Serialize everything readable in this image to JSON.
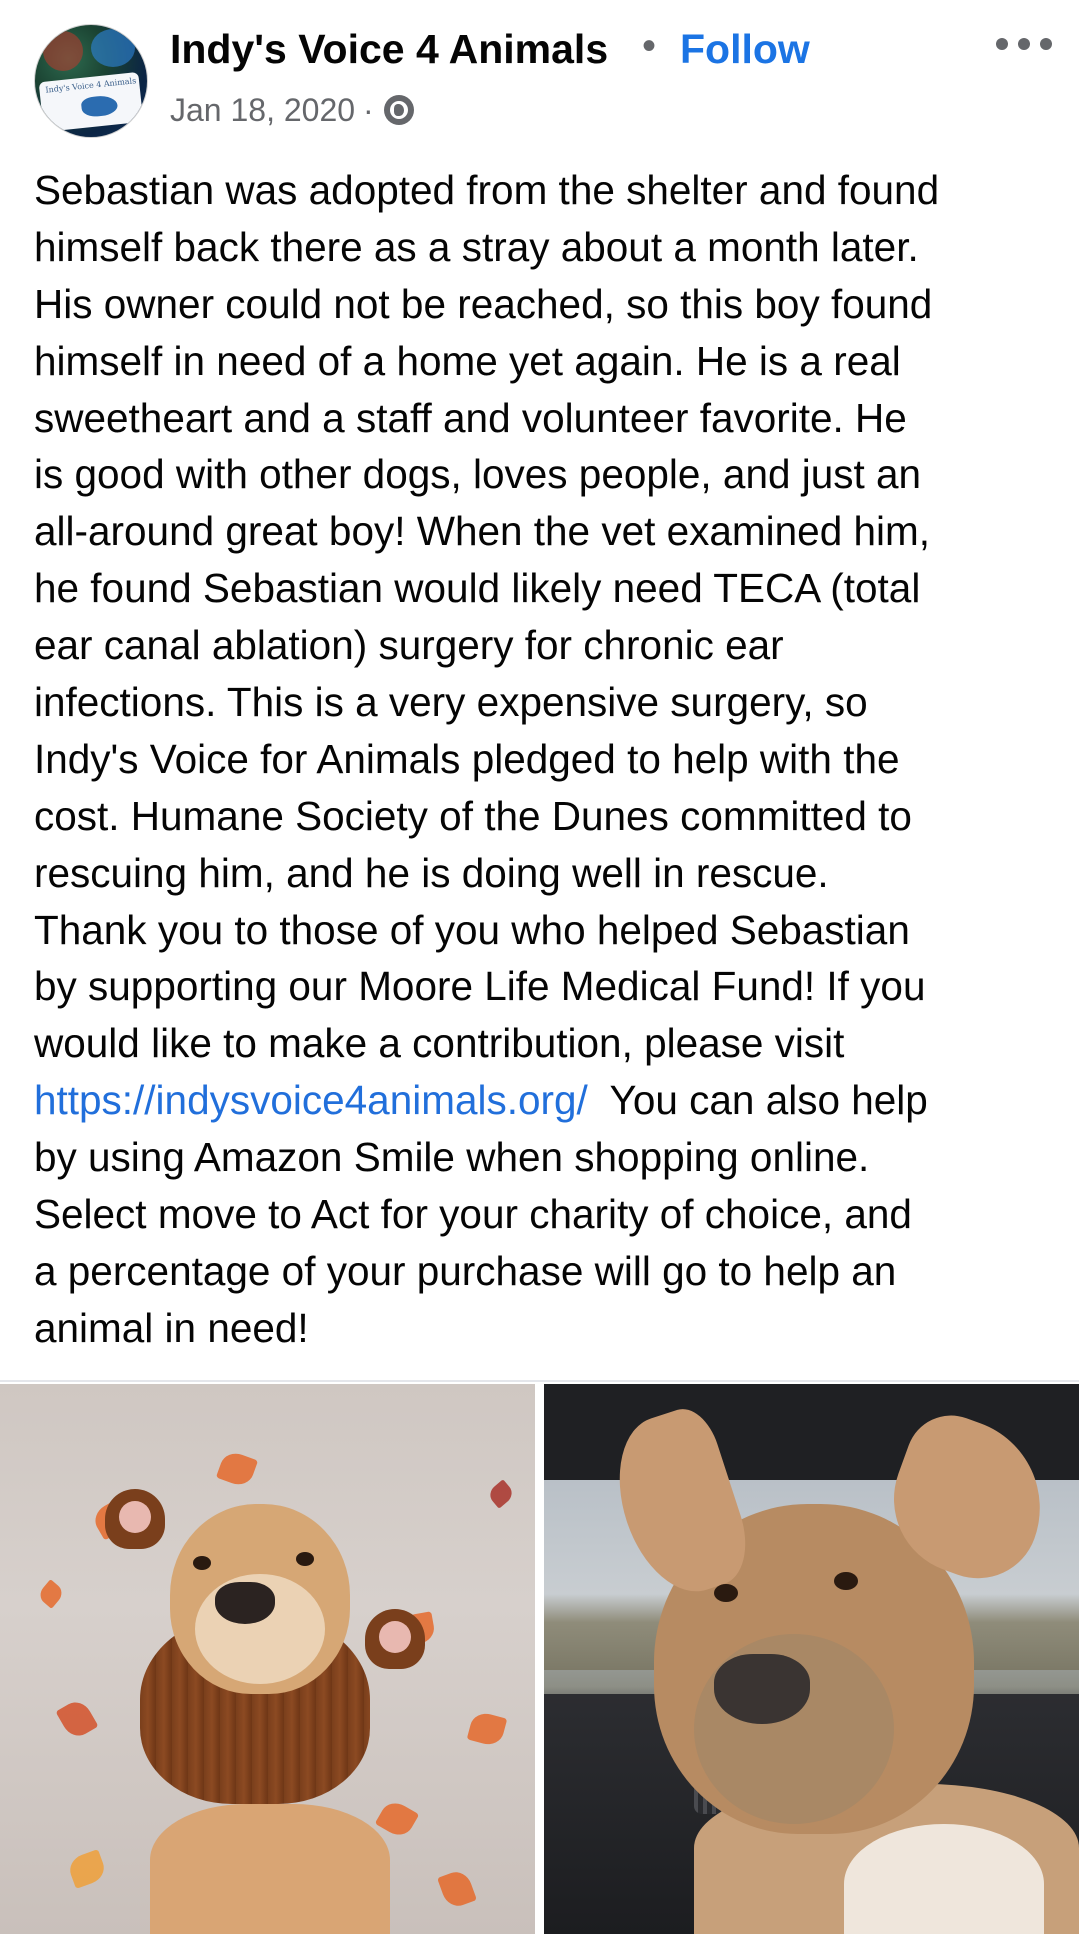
{
  "post": {
    "author": "Indy's Voice 4 Animals",
    "separator": "•",
    "follow_label": "Follow",
    "date": "Jan 18, 2020",
    "meta_separator": "·",
    "privacy_icon": "globe-icon",
    "more_icon": "more-options-icon",
    "avatar_badge_text": "Indy's Voice 4 Animals",
    "body_lines": [
      "Sebastian was adopted from the shelter and found",
      "himself back there as a stray about a month later.",
      "His owner could not be reached, so this boy found",
      "himself in need of a home yet again.  He is a real",
      "sweetheart and a staff and volunteer favorite.  He",
      "is good with other dogs, loves people, and just an",
      "all-around great boy!  When the vet examined him,",
      "he found Sebastian would likely need TECA (total",
      "ear canal ablation) surgery for chronic ear",
      "infections.  This is a very expensive surgery, so",
      "Indy's Voice for Animals pledged to help with the",
      "cost.  Humane Society of the Dunes committed to",
      "rescuing him, and he is doing well in rescue.",
      "Thank you to those of you who helped Sebastian",
      "by supporting our Moore Life Medical Fund!  If you",
      "would like to make a contribution, please visit"
    ],
    "link_text": "https://indysvoice4animals.org/",
    "link_line_tail": "  You can also help",
    "body_lines_after": [
      "by using Amazon Smile when shopping online.",
      "Select move to Act for your charity of choice, and",
      "a percentage of your purchase will go to help an",
      "animal in need!"
    ],
    "photos": [
      "dog-in-knit-hood-photo",
      "dog-in-car-photo"
    ],
    "colors": {
      "text": "#050505",
      "secondary": "#65676b",
      "follow": "#1b74e4",
      "link": "#216fdb"
    }
  }
}
